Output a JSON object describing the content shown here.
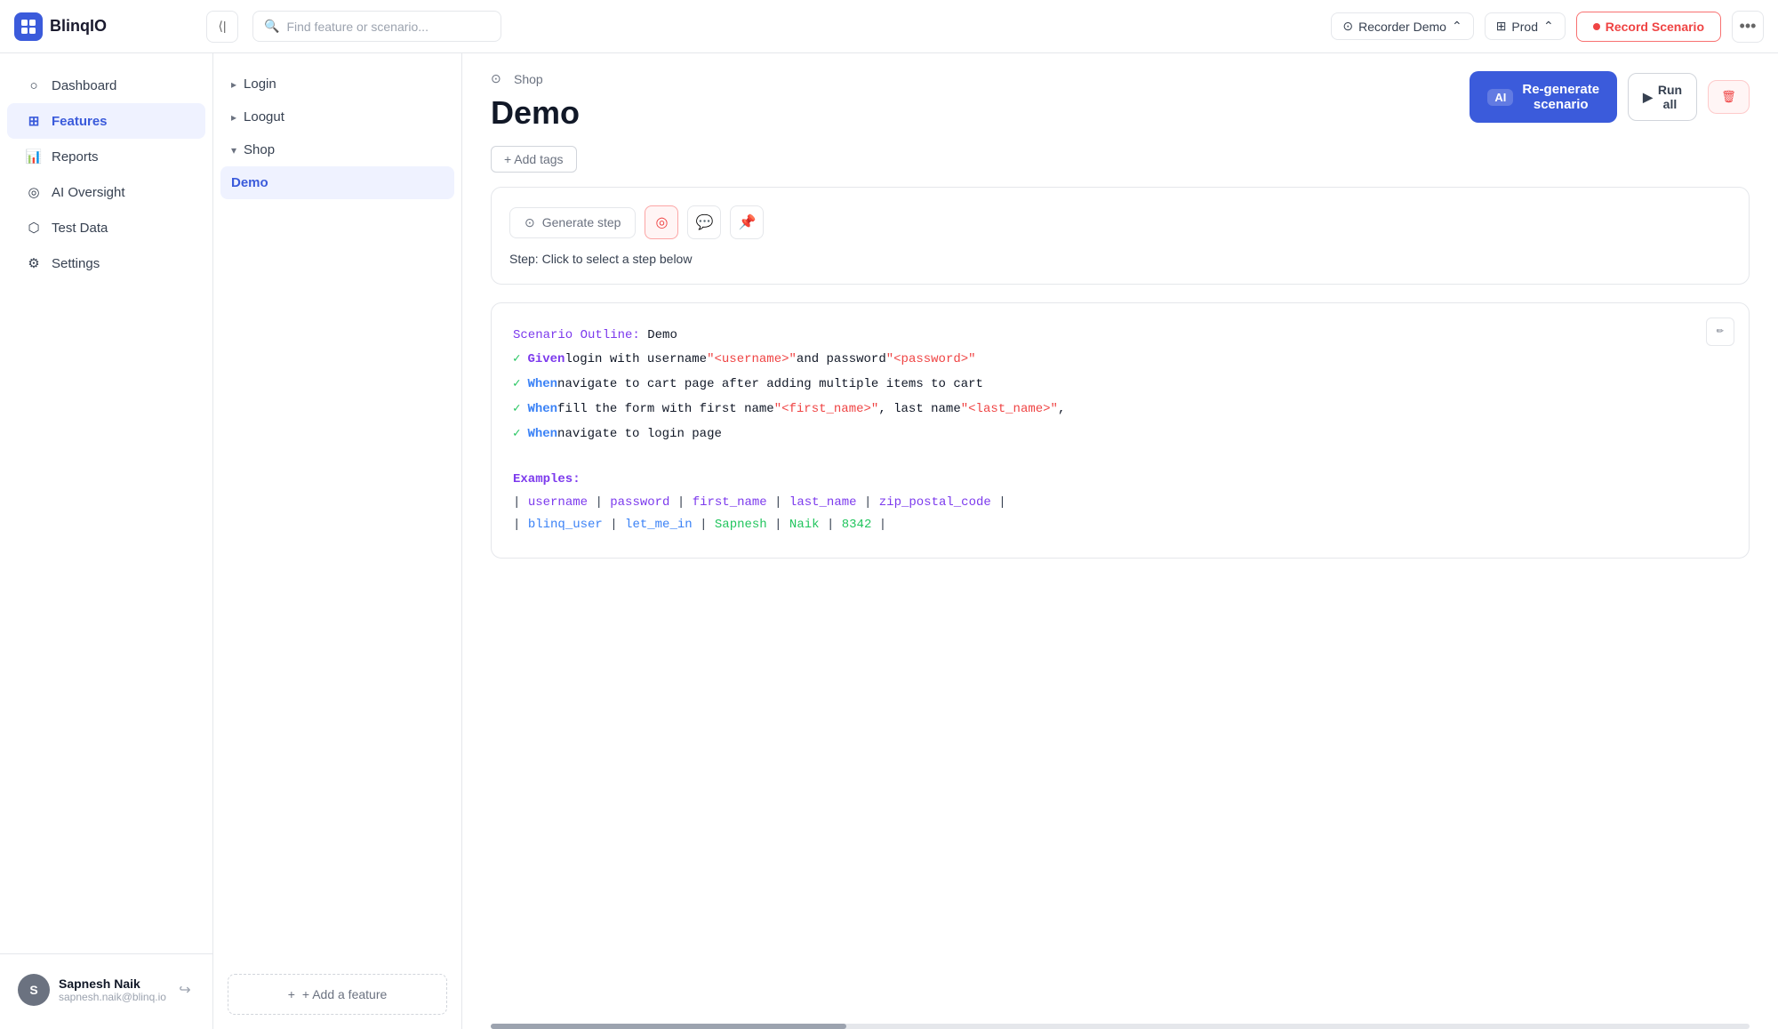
{
  "header": {
    "logo_text": "BlinqIO",
    "search_placeholder": "Find feature or scenario...",
    "recorder": "Recorder Demo",
    "env": "Prod",
    "record_btn": "Record Scenario",
    "more_icon": "•••"
  },
  "sidebar": {
    "items": [
      {
        "id": "dashboard",
        "label": "Dashboard",
        "icon": "dashboard-icon"
      },
      {
        "id": "features",
        "label": "Features",
        "icon": "features-icon",
        "active": true
      },
      {
        "id": "reports",
        "label": "Reports",
        "icon": "reports-icon"
      },
      {
        "id": "ai-oversight",
        "label": "AI Oversight",
        "icon": "ai-icon"
      },
      {
        "id": "test-data",
        "label": "Test Data",
        "icon": "test-data-icon"
      },
      {
        "id": "settings",
        "label": "Settings",
        "icon": "settings-icon"
      }
    ],
    "user": {
      "name": "Sapnesh Naik",
      "email": "sapnesh.naik@blinq.io",
      "avatar_initial": "S"
    }
  },
  "feature_tree": {
    "items": [
      {
        "id": "login",
        "label": "Login",
        "expanded": false
      },
      {
        "id": "logout",
        "label": "Loogut",
        "expanded": false
      },
      {
        "id": "shop",
        "label": "Shop",
        "expanded": true
      },
      {
        "id": "demo",
        "label": "Demo",
        "active": true
      }
    ],
    "add_feature_label": "+ Add a feature"
  },
  "main": {
    "breadcrumb": "Shop",
    "title": "Demo",
    "add_tags_label": "+ Add tags",
    "regenerate_label": "Re-generate\nscenario",
    "ai_badge": "AI",
    "run_all_label": "Run\nall",
    "generate_step_label": "Generate step",
    "step_hint_prefix": "Step:",
    "step_hint_text": "Click to select a step below",
    "scenario_outline_label": "Scenario Outline:",
    "scenario_name": "Demo",
    "steps": [
      {
        "keyword": "Given",
        "text": " login with username ",
        "params": [
          "\"<username>\"",
          " and password ",
          "\"<password>\""
        ]
      },
      {
        "keyword": "When",
        "text": " navigate to cart page after adding multiple items to cart"
      },
      {
        "keyword": "When",
        "text": " fill the form with first name ",
        "params": [
          "\"<first_name>\"",
          ", last name ",
          "\"<last_name>\","
        ]
      },
      {
        "keyword": "When",
        "text": " navigate to login page"
      }
    ],
    "examples_label": "Examples:",
    "table_headers": [
      "username",
      "password",
      "first_name",
      "last_name",
      "zip_postal_code"
    ],
    "table_rows": [
      [
        "blinq_user",
        "let_me_in",
        "Sapnesh",
        "Naik",
        "8342"
      ]
    ]
  }
}
